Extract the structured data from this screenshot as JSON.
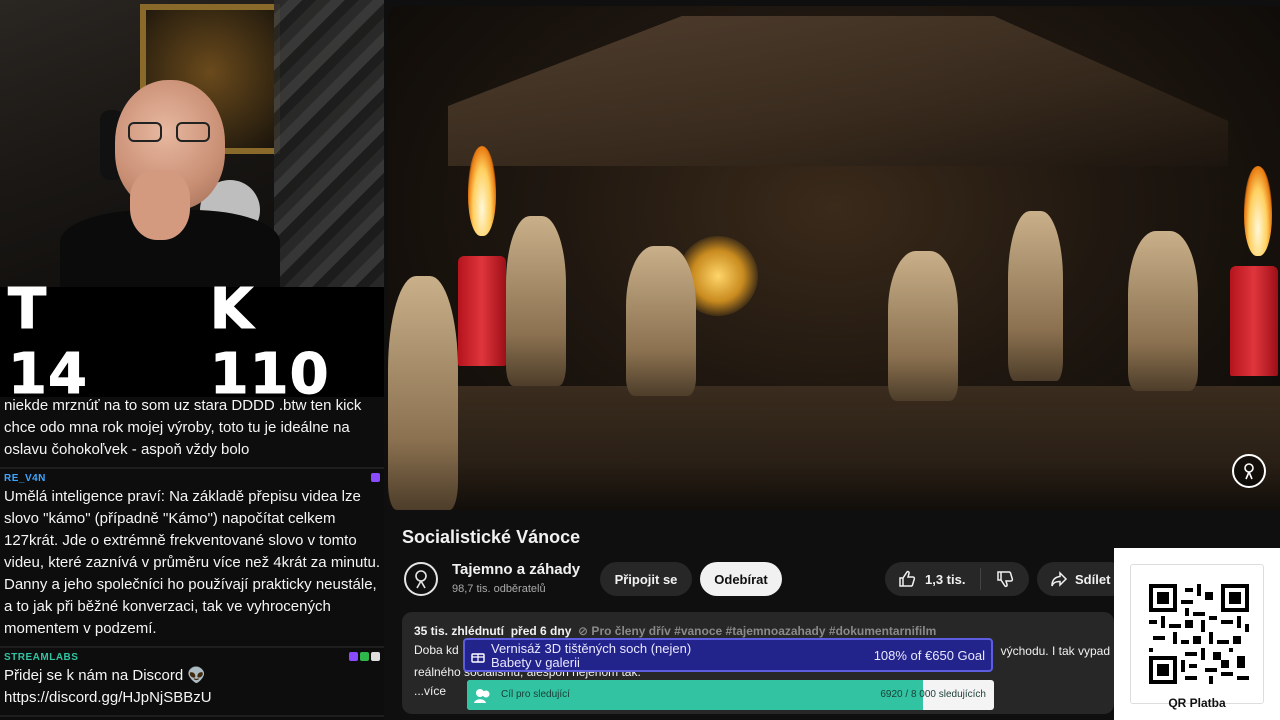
{
  "counters": {
    "t": "T 14",
    "k": "K 110"
  },
  "chat": [
    {
      "user": "",
      "text": "niekde mrznúť na to som uz stara DDDD .btw ten kick chce odo mna rok mojej výroby, toto tu je ideálne na oslavu čohokoľvek - aspoň vždy bolo"
    },
    {
      "user": "RE_V4N",
      "text": "Umělá inteligence praví: Na základě přepisu videa lze slovo \"kámo\" (případně \"Kámo\") napočítat celkem 127krát. Jde o extrémně frekventované slovo v tomto videu, které zaznívá v průměru více než 4krát za minutu. Danny a jeho společníci ho používají prakticky neustále, a to jak při běžné konverzaci, tak ve vyhrocených momentem v podzemí."
    },
    {
      "user": "STREAMLABS",
      "text": "Přidej se k nám na Discord 👽 https://discord.gg/HJpNjSBBzU"
    }
  ],
  "video": {
    "title": "Socialistické Vánoce",
    "channel_name": "Tajemno a záhady",
    "subscribers": "98,7 tis. odběratelů",
    "join_label": "Připojit se",
    "subscribe_label": "Odebírat",
    "likes": "1,3 tis.",
    "share_label": "Sdílet"
  },
  "description": {
    "views": "35 tis. zhlédnutí",
    "date": "před 6 dny",
    "members": "⊘ Pro členy dřív",
    "tags": "#vanoce #tajemnoazahady #dokumentarnifilm",
    "line1": "Doba kd",
    "line1_right": "východu. I tak vypad",
    "line2": "reálného socialismu, alespoň nejenom tak.",
    "more": "...více"
  },
  "goal_art": {
    "line1": "Vernisáž 3D tištěných soch (nejen)",
    "line2": "Babety v galerii",
    "percent": "108% of €650 Goal"
  },
  "goal_followers": {
    "label": "Cíl pro sledující",
    "count": "6920 / 8 000 sledujících",
    "progress": 0.865
  },
  "qr": {
    "caption": "QR Platba"
  },
  "colors": {
    "accent_blue": "#3ea6ff",
    "streamlabs": "#31c3a2",
    "goal_bg": "#23238c"
  }
}
